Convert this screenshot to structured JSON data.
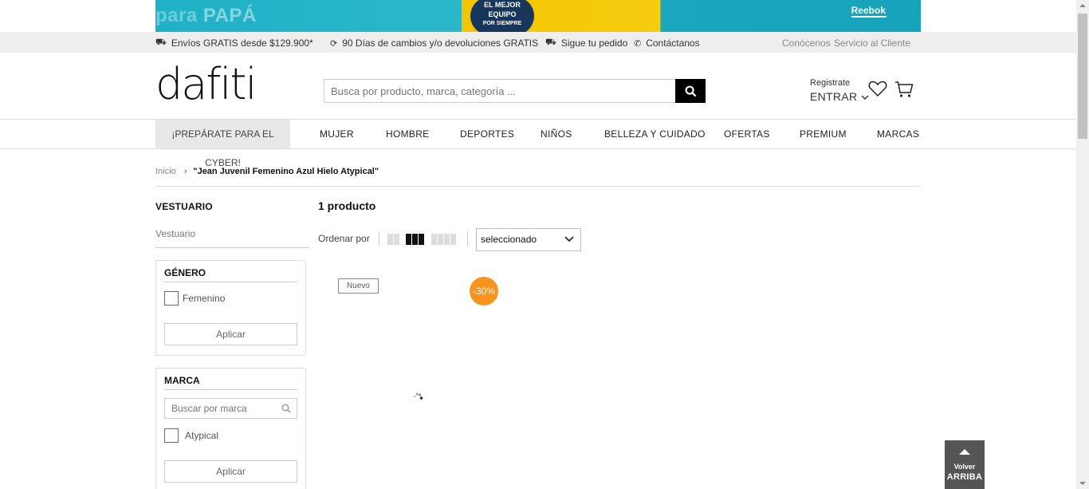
{
  "banner": {
    "left_text_a": "para",
    "left_text_b": "PAPÁ",
    "badge_line1": "EL MEJOR",
    "badge_line2": "EQUIPO",
    "badge_line3": "POR SIEMPRE",
    "brand": "Reebok"
  },
  "topbar": {
    "shipping": "Envíos GRATIS desde $129.900*",
    "returns": "90 Días de cambios y/o devoluciones GRATIS",
    "tracking": "Sigue tu pedido",
    "contact": "Contáctanos",
    "about": "Conócenos",
    "service": "Servicio al Cliente"
  },
  "header": {
    "logo": "dafiti",
    "search_placeholder": "Busca por producto, marca, categoría ...",
    "register": "Registrate",
    "login": "ENTRAR"
  },
  "nav": {
    "cyber": "¡PREPÁRATE PARA EL CYBER!",
    "items": [
      "MUJER",
      "HOMBRE",
      "DEPORTES",
      "NIÑOS",
      "BELLEZA Y CUIDADO",
      "OFERTAS",
      "PREMIUM",
      "MARCAS"
    ]
  },
  "breadcrumb": {
    "home": "Inicio",
    "current": "\"Jean Juvenil Femenino Azul Hielo Atypical\""
  },
  "sidebar": {
    "title": "VESTUARIO",
    "subtitle": "Vestuario",
    "gender": {
      "heading": "GÉNERO",
      "option": "Femenino",
      "apply": "Aplicar"
    },
    "brand": {
      "heading": "MARCA",
      "placeholder": "Buscar por marca",
      "option": "Atypical",
      "apply": "Aplicar"
    }
  },
  "results": {
    "count": "1 producto",
    "sort_label": "Ordenar por",
    "sort_value": "seleccionado",
    "grid_selected": "3 columns"
  },
  "product": {
    "badge": "Nuevo",
    "discount": "-30%"
  },
  "back_to_top": {
    "line1": "Volver",
    "line2": "ARRIBA"
  },
  "colors": {
    "accent": "#f7941d",
    "search_button": "#000000",
    "banner_teal": "#1fb1c7",
    "banner_yellow": "#f3c500"
  }
}
